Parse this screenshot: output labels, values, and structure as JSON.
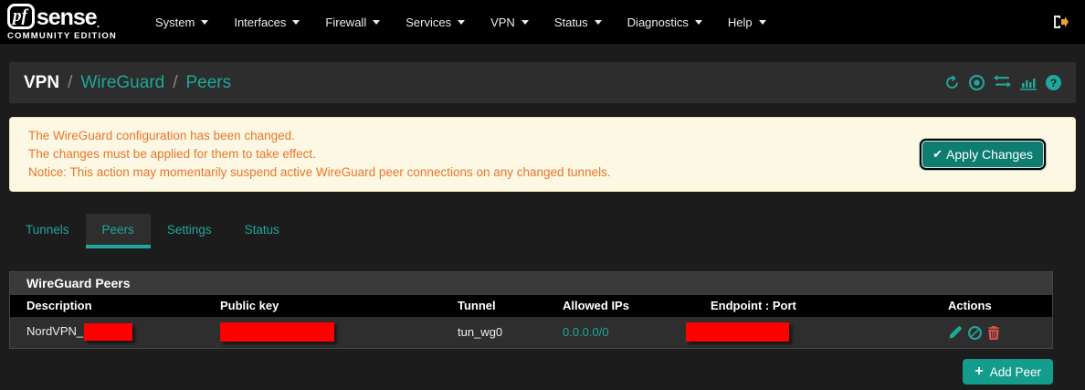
{
  "colors": {
    "accent": "#1ea79a",
    "accent-btn": "#149c8c",
    "apply-bg": "#0d7d71",
    "danger": "#d9534f",
    "alert-bg": "#fcf8e3",
    "alert-text": "#e8762d",
    "redaction": "#ff0000"
  },
  "navbar": {
    "logo": {
      "pf": "pf",
      "sense": "sense",
      "dot": ".",
      "edition": "COMMUNITY EDITION"
    },
    "items": [
      {
        "label": "System"
      },
      {
        "label": "Interfaces"
      },
      {
        "label": "Firewall"
      },
      {
        "label": "Services"
      },
      {
        "label": "VPN"
      },
      {
        "label": "Status"
      },
      {
        "label": "Diagnostics"
      },
      {
        "label": "Help"
      }
    ]
  },
  "breadcrumb": {
    "root": "VPN",
    "sep": "/",
    "app": "WireGuard",
    "page": "Peers",
    "help_glyph": "?"
  },
  "alert": {
    "lines": [
      "The WireGuard configuration has been changed.",
      "The changes must be applied for them to take effect.",
      "Notice: This action may momentarily suspend active WireGuard peer connections on any changed tunnels."
    ],
    "apply_check": "✔",
    "apply_label": "Apply Changes"
  },
  "tabs": [
    {
      "label": "Tunnels",
      "active": false
    },
    {
      "label": "Peers",
      "active": true
    },
    {
      "label": "Settings",
      "active": false
    },
    {
      "label": "Status",
      "active": false
    }
  ],
  "panel": {
    "title": "WireGuard Peers",
    "headers": {
      "description": "Description",
      "public_key": "Public key",
      "tunnel": "Tunnel",
      "allowed_ips": "Allowed IPs",
      "endpoint_port": "Endpoint : Port",
      "actions": "Actions"
    },
    "rows": [
      {
        "description": "NordVPN_",
        "description_redacted": true,
        "public_key_redacted": true,
        "tunnel": "tun_wg0",
        "allowed_ips": "0.0.0.0/0",
        "endpoint_redacted": true
      }
    ]
  },
  "footer": {
    "add_plus": "+",
    "add_label": "Add Peer"
  }
}
